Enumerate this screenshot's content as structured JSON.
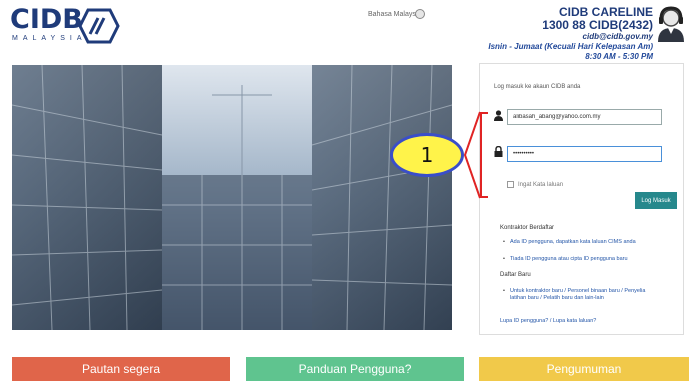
{
  "header": {
    "logo_text": "CIDB",
    "logo_subtext": "MALAYSIA",
    "language_link": "Bahasa Malaysia",
    "careline": {
      "title": "CIDB CARELINE",
      "phone": "1300 88 CIDB(2432)",
      "email": "cidb@cidb.gov.my",
      "days": "Isnin - Jumaat (Kecuali Hari Kelepasan Am)",
      "hours": "8:30 AM - 5:30 PM"
    }
  },
  "login": {
    "title": "Log masuk ke akaun CIDB anda",
    "username_value": "alibasah_abang@yahoo.com.my",
    "password_value": "••••••••••",
    "remember_label": "Ingat Kata laluan",
    "login_button": "Log Masuk",
    "registered_heading": "Kontraktor Berdaftar",
    "registered_items": [
      "Ada ID pengguna, dapatkan kata laluan CIMS anda",
      "Tiada ID pengguna atau cipta ID pengguna baru"
    ],
    "new_heading": "Daftar Baru",
    "new_items": [
      "Untuk kontraktor baru / Personel binaan baru / Penyelia latihan baru / Pelatih baru dan lain-lain"
    ],
    "forgot_link": "Lupa ID pengguna? / Lupa kata laluan?"
  },
  "annotation": {
    "number": "1",
    "colors": {
      "fill": "#fff34a",
      "border": "#3a4ec9",
      "line": "#e02424"
    }
  },
  "bottom_buttons": {
    "left": "Pautan segera",
    "middle": "Panduan Pengguna?",
    "right": "Pengumuman"
  },
  "colors": {
    "brand": "#1f3b7a",
    "login_button": "#26888c",
    "pautan": "#e0654a",
    "panduan": "#5fc48f",
    "pengumuman": "#f1c94a"
  },
  "icons": {
    "language": "globe-icon",
    "agent": "headset-agent-icon",
    "username": "user-icon",
    "password": "lock-icon"
  }
}
